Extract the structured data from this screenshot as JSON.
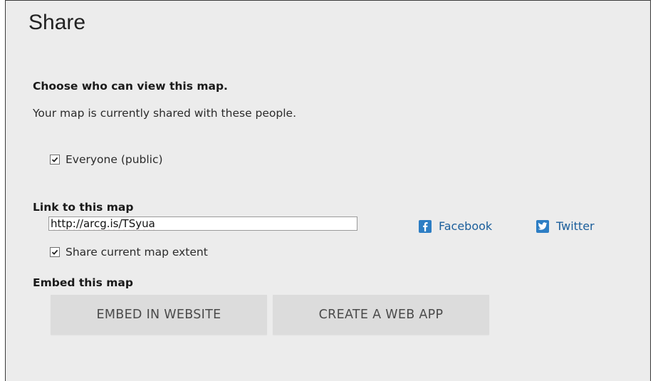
{
  "dialog": {
    "title": "Share",
    "view_heading": "Choose who can view this map.",
    "shared_text": "Your map is currently shared with these people.",
    "everyone_checkbox": {
      "label": "Everyone (public)",
      "checked": true
    },
    "link_heading": "Link to this map",
    "link_url": "http://arcg.is/TSyua",
    "share_extent_checkbox": {
      "label": "Share current map extent",
      "checked": true
    },
    "social": {
      "facebook_label": "Facebook",
      "twitter_label": "Twitter",
      "facebook_icon": "facebook-icon",
      "twitter_icon": "twitter-icon"
    },
    "embed_heading": "Embed this map",
    "embed_website_label": "EMBED IN WEBSITE",
    "create_web_app_label": "CREATE A WEB APP"
  },
  "colors": {
    "background": "#ececec",
    "link": "#1b5e9b",
    "social_icon": "#2d7ec4",
    "button": "#dcdcdc"
  }
}
